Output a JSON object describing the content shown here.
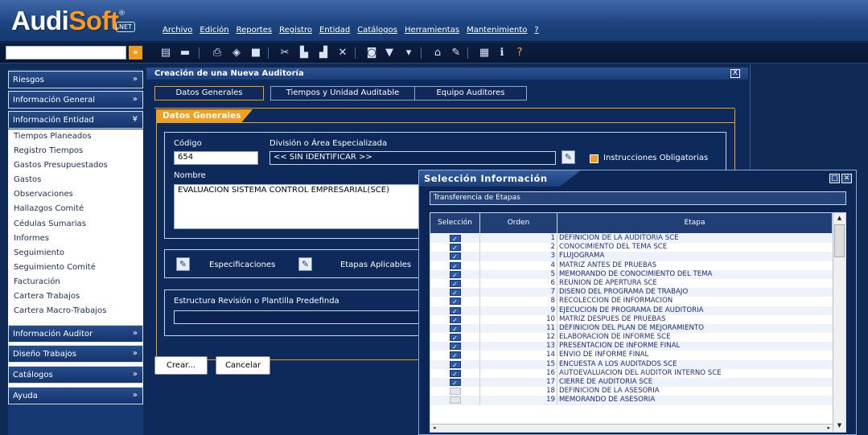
{
  "app": {
    "logo_main": "Audi",
    "logo_accent": "Soft",
    "logo_reg": "®",
    "logo_badge": "NET"
  },
  "menu": [
    "Archivo",
    "Edición",
    "Reportes",
    "Registro",
    "Entidad",
    "Catálogos",
    "Herramientas",
    "Mantenimiento",
    "?"
  ],
  "toolbar": {
    "search_value": "",
    "go_label": "»",
    "icons": [
      "new-record-icon",
      "open-folder-icon",
      "print-icon",
      "tag-icon",
      "save-icon",
      "cut-icon",
      "copy-icon",
      "paste-icon",
      "delete-icon",
      "print-preview-icon",
      "filter-icon",
      "clear-filter-icon",
      "lock-icon",
      "edit-icon",
      "table-icon",
      "info-icon",
      "help-icon"
    ]
  },
  "sidebar": {
    "sections": [
      {
        "label": "Riesgos",
        "chevron": "»"
      },
      {
        "label": "Información General",
        "chevron": "»"
      },
      {
        "label": "Información Entidad",
        "chevron": "¥"
      },
      {
        "label": "Información Auditor",
        "chevron": "»"
      },
      {
        "label": "Diseño Trabajos",
        "chevron": "»"
      },
      {
        "label": "Catálogos",
        "chevron": "»"
      },
      {
        "label": "Ayuda",
        "chevron": "»"
      }
    ],
    "items": [
      "Tiempos Planeados",
      "Registro Tiempos",
      "Gastos Presupuestados",
      "Gastos",
      "Observaciones",
      "Hallazgos Comité",
      "Cédulas Sumarias",
      "Informes",
      "Seguimiento",
      "Seguimiento Comité",
      "Facturación",
      "Cartera Trabajos",
      "Cartera Macro-Trabajos"
    ]
  },
  "main": {
    "title": "Creación de una Nueva Auditoría",
    "close": "X",
    "tabs": [
      "Datos Generales",
      "Tiempos y Unidad Auditable",
      "Equipo Auditores"
    ],
    "section_header": "Datos Generales",
    "codigo_label": "Código",
    "codigo_value": "654",
    "division_label": "División o Área Especializada",
    "division_value": "<< SIN IDENTIFICAR >>",
    "instrucciones_label": "Instrucciones Obligatorias",
    "nombre_label": "Nombre",
    "nombre_value": "EVALUACION SISTEMA CONTROL EMPRESARIAL(SCE)",
    "especificaciones_label": "Especificaciones",
    "etapas_label": "Etapas Aplicables",
    "estructura_label": "Estructura Revisión o Plantilla Predefinda",
    "estructura_value": "",
    "crear_label": "Crear...",
    "cancelar_label": "Cancelar"
  },
  "popup": {
    "title": "Selección Información",
    "subtitle": "Transferencia de Etapas",
    "columns": [
      "Selección",
      "Orden",
      "Etapa"
    ],
    "rows": [
      {
        "selected": true,
        "orden": 1,
        "etapa": "DEFINICION DE LA AUDITORIA SCE"
      },
      {
        "selected": true,
        "orden": 2,
        "etapa": "CONOCIMIENTO DEL TEMA SCE"
      },
      {
        "selected": true,
        "orden": 3,
        "etapa": "FLUJOGRAMA"
      },
      {
        "selected": true,
        "orden": 4,
        "etapa": "MATRIZ ANTES DE PRUEBAS"
      },
      {
        "selected": true,
        "orden": 5,
        "etapa": "MEMORANDO DE CONOCIMIENTO DEL TEMA"
      },
      {
        "selected": true,
        "orden": 6,
        "etapa": "REUNION DE APERTURA SCE"
      },
      {
        "selected": true,
        "orden": 7,
        "etapa": "DISEÑO DEL PROGRAMA DE TRABAJO"
      },
      {
        "selected": true,
        "orden": 8,
        "etapa": "RECOLECCION DE INFORMACION"
      },
      {
        "selected": true,
        "orden": 9,
        "etapa": "EJECUCION DE PROGRAMA DE AUDITORIA"
      },
      {
        "selected": true,
        "orden": 10,
        "etapa": "MATRIZ DESPUES DE PRUEBAS"
      },
      {
        "selected": true,
        "orden": 11,
        "etapa": "DEFINICION DEL PLAN DE MEJORAMIENTO"
      },
      {
        "selected": true,
        "orden": 12,
        "etapa": "ELABORACION DE INFORME SCE"
      },
      {
        "selected": true,
        "orden": 13,
        "etapa": "PRESENTACION DE INFORME FINAL"
      },
      {
        "selected": true,
        "orden": 14,
        "etapa": "ENVIO DE INFORME FINAL"
      },
      {
        "selected": true,
        "orden": 15,
        "etapa": "ENCUESTA A LOS AUDITADOS SCE"
      },
      {
        "selected": true,
        "orden": 16,
        "etapa": "AUTOEVALUACIÓN DEL AUDITOR INTERNO SCE"
      },
      {
        "selected": true,
        "orden": 17,
        "etapa": "CIERRE DE AUDITORIA SCE"
      },
      {
        "selected": false,
        "orden": 18,
        "etapa": "DEFINICION DE LA ASESORIA"
      },
      {
        "selected": false,
        "orden": 19,
        "etapa": "MEMORANDO DE ASESORIA"
      }
    ]
  }
}
